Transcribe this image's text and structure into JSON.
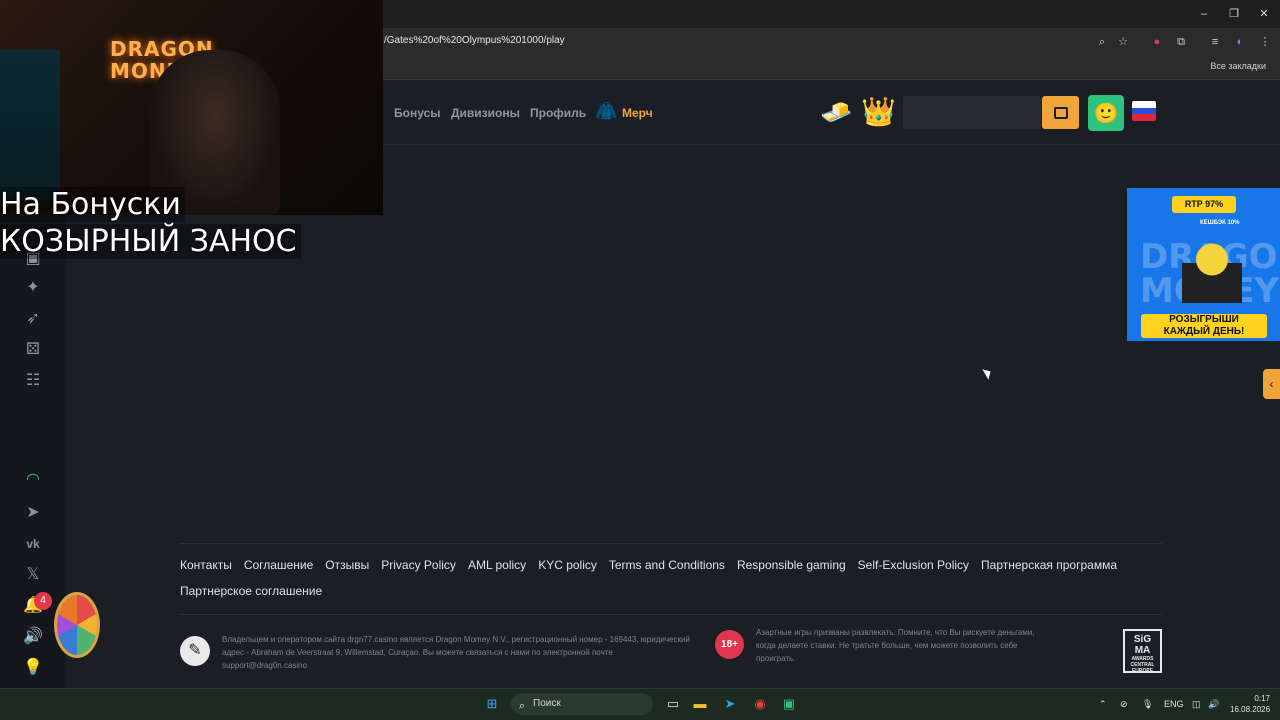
{
  "browser": {
    "url": "/Gates%20of%20Olympus%201000/play",
    "bookmarks_label": "Все закладки",
    "window_controls": {
      "minimize": "–",
      "restore": "❐",
      "close": "✕"
    }
  },
  "header": {
    "nav": [
      {
        "label": "Бонусы"
      },
      {
        "label": "Дивизионы"
      },
      {
        "label": "Профиль"
      },
      {
        "label": "Мерч"
      }
    ]
  },
  "stream_overlay": {
    "neon_sign": "DRAGON\nMONEY",
    "line1": "На Бонуски",
    "line2": "КОЗЫРНЫЙ ЗАНОС"
  },
  "ad": {
    "rtp": "RTP 97%",
    "cashback": "КЕШБЭК 10%",
    "brand": "DRAGON MONEY",
    "cta_line1": "РОЗЫГРЫШИ",
    "cta_line2": "КАЖДЫЙ ДЕНЬ!"
  },
  "sidebar": {
    "notification_count": "4"
  },
  "footer": {
    "links": [
      "Контакты",
      "Соглашение",
      "Отзывы",
      "Privacy Policy",
      "AML policy",
      "KYC policy",
      "Terms and Conditions",
      "Responsible gaming",
      "Self-Exclusion Policy",
      "Партнерская программа",
      "Партнерское соглашение"
    ],
    "legal_text": "Владельцем и оператором сайта drgn77.casino является Dragon Momey N.V., регистрационный номер - 169443, юридический адрес - Abraham de Veerstraat 9, Willemstad, Curaçao. Вы можете связаться с нами по электронной почте support@drag0n.casino",
    "age_badge": "18+",
    "warning_text": "Азартные игры призваны развлекать. Помните, что Вы рискуете деньгами, когда делаете ставки. Не тратьте больше, чем можете позволить себе проиграть.",
    "sigma": {
      "line1": "SiG",
      "line2": "MA",
      "line3": "AWARDS",
      "line4": "CENTRAL EUROPE"
    }
  },
  "taskbar": {
    "search_placeholder": "Поиск",
    "language": "ENG",
    "time": "0:17",
    "date": "16.08.2026"
  },
  "colors": {
    "accent": "#f0a43a",
    "background": "#1b1e25",
    "sidebar": "#15171c",
    "badge": "#e2364d",
    "avatar": "#2ec37c",
    "ad_blue": "#1976e8",
    "ad_yellow": "#ffd21f"
  }
}
